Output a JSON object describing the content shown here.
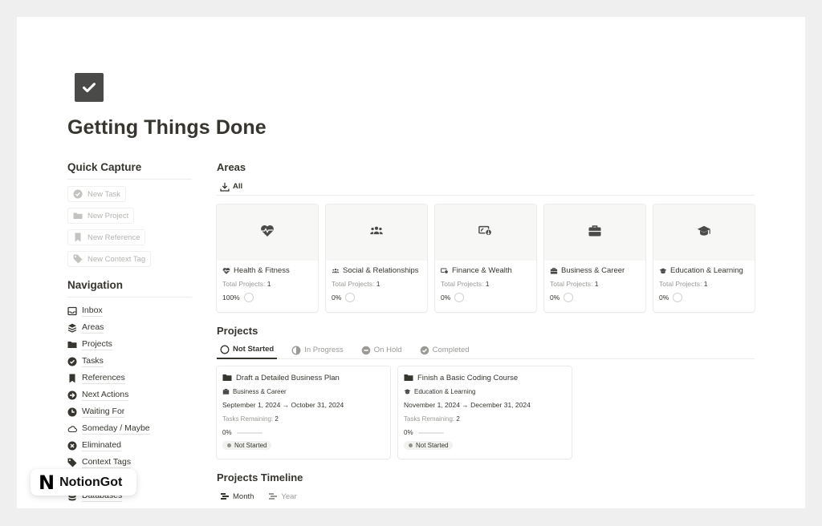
{
  "page": {
    "title": "Getting Things Done",
    "icon": "checkbox-icon"
  },
  "quick_capture": {
    "heading": "Quick Capture",
    "buttons": [
      {
        "label": "New Task",
        "icon": "check-circle-icon"
      },
      {
        "label": "New Project",
        "icon": "folder-icon"
      },
      {
        "label": "New Reference",
        "icon": "bookmark-icon"
      },
      {
        "label": "New Context Tag",
        "icon": "tag-icon"
      }
    ]
  },
  "navigation": {
    "heading": "Navigation",
    "items": [
      {
        "label": "Inbox",
        "icon": "inbox-icon"
      },
      {
        "label": "Areas",
        "icon": "layers-icon"
      },
      {
        "label": "Projects",
        "icon": "folder-icon"
      },
      {
        "label": "Tasks",
        "icon": "check-circle-icon"
      },
      {
        "label": "References",
        "icon": "bookmark-icon"
      },
      {
        "label": "Next Actions",
        "icon": "arrow-circle-icon"
      },
      {
        "label": "Waiting For",
        "icon": "clock-icon"
      },
      {
        "label": "Someday / Maybe",
        "icon": "cloud-icon"
      },
      {
        "label": "Eliminated",
        "icon": "x-circle-icon"
      },
      {
        "label": "Context Tags",
        "icon": "tag-icon"
      },
      {
        "label": "Databases",
        "icon": "database-icon"
      }
    ]
  },
  "areas": {
    "heading": "Areas",
    "view_label": "All",
    "cards": [
      {
        "name": "Health & Fitness",
        "icon": "heart-pulse-icon",
        "total_label": "Total Projects:",
        "total": "1",
        "progress": "100%"
      },
      {
        "name": "Social & Relationships",
        "icon": "people-icon",
        "total_label": "Total Projects:",
        "total": "1",
        "progress": "0%"
      },
      {
        "name": "Finance & Wealth",
        "icon": "money-icon",
        "total_label": "Total Projects:",
        "total": "1",
        "progress": "0%"
      },
      {
        "name": "Business & Career",
        "icon": "briefcase-icon",
        "total_label": "Total Projects:",
        "total": "1",
        "progress": "0%"
      },
      {
        "name": "Education & Learning",
        "icon": "graduation-cap-icon",
        "total_label": "Total Projects:",
        "total": "1",
        "progress": "0%"
      }
    ]
  },
  "projects": {
    "heading": "Projects",
    "tabs": [
      {
        "label": "Not Started",
        "active": true
      },
      {
        "label": "In Progress",
        "active": false
      },
      {
        "label": "On Hold",
        "active": false
      },
      {
        "label": "Completed",
        "active": false
      }
    ],
    "cards": [
      {
        "title": "Draft a Detailed Business Plan",
        "area": "Business & Career",
        "dates": "September 1, 2024 → October 31, 2024",
        "tasks_label": "Tasks Remaining:",
        "tasks": "2",
        "progress": "0%",
        "progress_fraction": 0,
        "status": "Not Started"
      },
      {
        "title": "Finish a Basic Coding Course",
        "area": "Education & Learning",
        "dates": "November 1, 2024 → December 31, 2024",
        "tasks_label": "Tasks Remaining:",
        "tasks": "2",
        "progress": "0%",
        "progress_fraction": 0,
        "status": "Not Started"
      }
    ]
  },
  "timeline": {
    "heading": "Projects Timeline",
    "tabs": [
      {
        "label": "Month",
        "active": true
      },
      {
        "label": "Year",
        "active": false
      }
    ]
  },
  "badge": {
    "logo": "N",
    "text": "NotionGot"
  },
  "colors": {
    "text": "#37352f",
    "muted": "#9b9a97",
    "icon_bg": "#4a4a48"
  }
}
